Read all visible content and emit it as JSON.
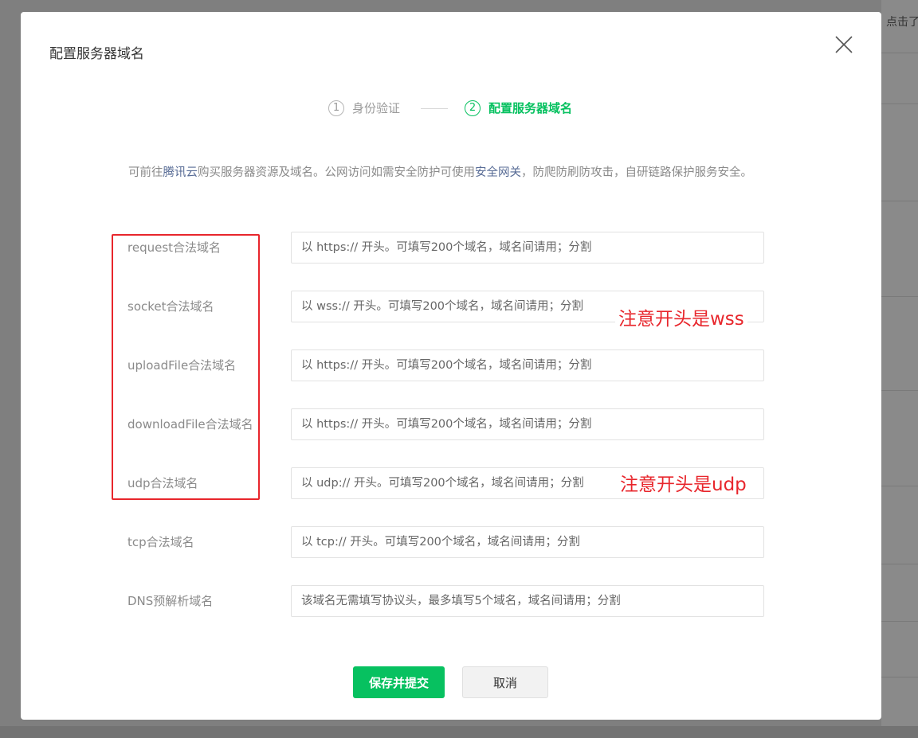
{
  "background": {
    "side_text": "点击了"
  },
  "dialog": {
    "title": "配置服务器域名",
    "steps": [
      {
        "number": "1",
        "label": "身份验证"
      },
      {
        "number": "2",
        "label": "配置服务器域名"
      }
    ],
    "intro": {
      "part1": "可前往",
      "link1": "腾讯云",
      "part2": "购买服务器资源及域名。公网访问如需安全防护可使用",
      "link2": "安全网关",
      "part3": "，防爬防刷防攻击，自研链路保护服务安全。"
    },
    "fields": [
      {
        "label": "request合法域名",
        "placeholder": "以 https:// 开头。可填写200个域名，域名间请用；分割",
        "value": ""
      },
      {
        "label": "socket合法域名",
        "placeholder": "以 wss:// 开头。可填写200个域名，域名间请用；分割",
        "value": ""
      },
      {
        "label": "uploadFile合法域名",
        "placeholder": "以 https:// 开头。可填写200个域名，域名间请用；分割",
        "value": ""
      },
      {
        "label": "downloadFile合法域名",
        "placeholder": "以 https:// 开头。可填写200个域名，域名间请用；分割",
        "value": ""
      },
      {
        "label": "udp合法域名",
        "placeholder": "以 udp:// 开头。可填写200个域名，域名间请用；分割",
        "value": ""
      },
      {
        "label": "tcp合法域名",
        "placeholder": "以 tcp:// 开头。可填写200个域名，域名间请用；分割",
        "value": ""
      },
      {
        "label": "DNS预解析域名",
        "placeholder": "该域名无需填写协议头，最多填写5个域名，域名间请用；分割",
        "value": ""
      }
    ],
    "annotations": {
      "wss_note": "注意开头是wss",
      "udp_note": "注意开头是udp"
    },
    "buttons": {
      "save": "保存并提交",
      "cancel": "取消"
    }
  },
  "colors": {
    "primary_green": "#07c160",
    "link_blue": "#576b95",
    "annotation_red": "#e8262c"
  },
  "icons": {
    "close": "close-icon"
  }
}
